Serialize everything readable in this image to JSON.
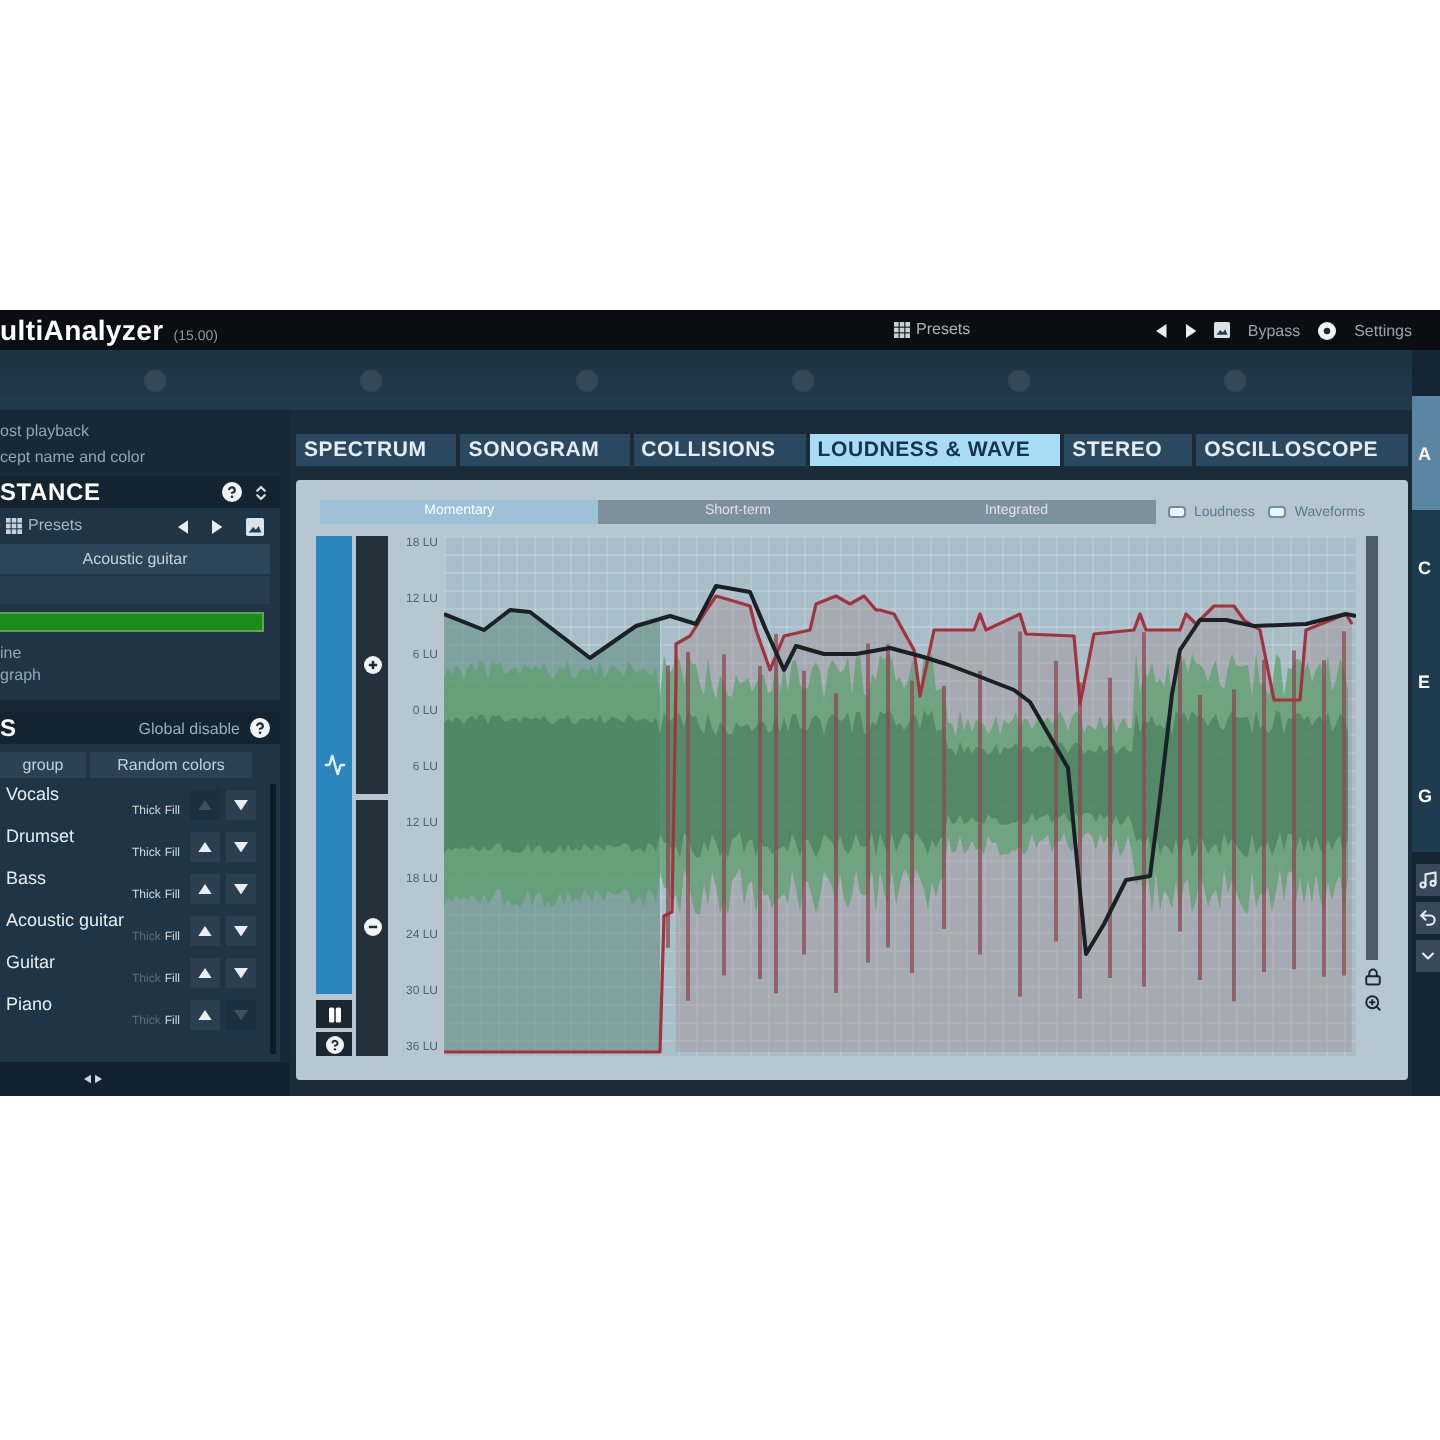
{
  "title_bar": {
    "title": "ultiAnalyzer",
    "version": "(15.00)",
    "presets": "Presets",
    "bypass": "Bypass",
    "settings": "Settings"
  },
  "left_panel": {
    "notes": [
      "ost playback",
      "cept name and color"
    ],
    "instance": {
      "title": "STANCE",
      "presets": "Presets",
      "name": "Acoustic guitar",
      "options": [
        "ine",
        "graph"
      ]
    },
    "instances": {
      "title": "S",
      "global_disable": "Global disable",
      "buttons": [
        "group",
        "Random colors"
      ],
      "items": [
        {
          "name": "Vocals",
          "thick_label": "Thick",
          "fill_label": "Fill",
          "thick": true,
          "fill": true,
          "up_disabled": true,
          "down_disabled": false
        },
        {
          "name": "Drumset",
          "thick_label": "Thick",
          "fill_label": "Fill",
          "thick": true,
          "fill": true,
          "up_disabled": false,
          "down_disabled": false
        },
        {
          "name": "Bass",
          "thick_label": "Thick",
          "fill_label": "Fill",
          "thick": true,
          "fill": true,
          "up_disabled": false,
          "down_disabled": false
        },
        {
          "name": "Acoustic guitar",
          "thick_label": "Thick",
          "fill_label": "Fill",
          "thick": false,
          "fill": true,
          "up_disabled": false,
          "down_disabled": false
        },
        {
          "name": "Guitar",
          "thick_label": "Thick",
          "fill_label": "Fill",
          "thick": false,
          "fill": true,
          "up_disabled": false,
          "down_disabled": false
        },
        {
          "name": "Piano",
          "thick_label": "Thick",
          "fill_label": "Fill",
          "thick": false,
          "fill": true,
          "up_disabled": false,
          "down_disabled": true
        }
      ]
    }
  },
  "tabs": [
    {
      "label": "SPECTRUM",
      "selected": false
    },
    {
      "label": "SONOGRAM",
      "selected": false
    },
    {
      "label": "COLLISIONS",
      "selected": false
    },
    {
      "label": "LOUDNESS & WAVE",
      "selected": true
    },
    {
      "label": "STEREO",
      "selected": false
    },
    {
      "label": "OSCILLOSCOPE",
      "selected": false
    }
  ],
  "view": {
    "modes": [
      {
        "label": "Momentary",
        "selected": true
      },
      {
        "label": "Short-term",
        "selected": false
      },
      {
        "label": "Integrated",
        "selected": false
      }
    ],
    "toggles": [
      {
        "label": "Loudness",
        "checked": true
      },
      {
        "label": "Waveforms",
        "checked": true
      }
    ],
    "y_axis_labels": [
      "18 LU",
      "12 LU",
      "6 LU",
      "0 LU",
      "6 LU",
      "12 LU",
      "18 LU",
      "24 LU",
      "30 LU",
      "36 LU"
    ]
  },
  "side_panel": {
    "sections": [
      {
        "label": "A",
        "selected": true
      },
      {
        "label": "C",
        "selected": false
      },
      {
        "label": "E",
        "selected": false
      },
      {
        "label": "G",
        "selected": false
      }
    ]
  }
}
